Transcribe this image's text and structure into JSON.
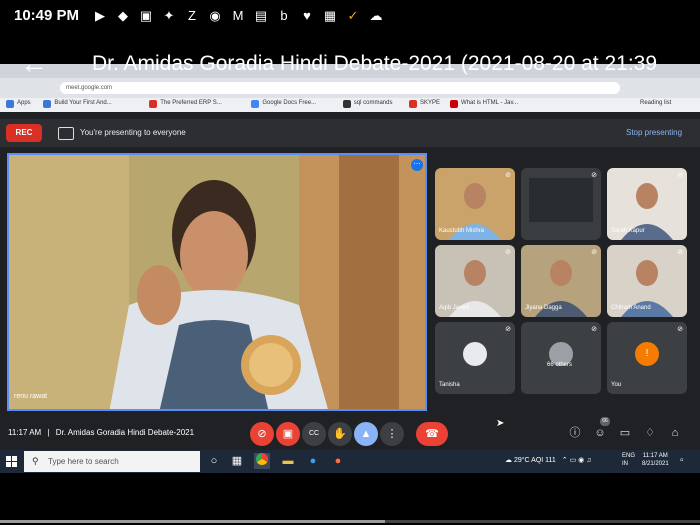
{
  "status_bar": {
    "time": "10:49 PM",
    "icons": [
      "youtube-icon",
      "shield-icon",
      "flipboard-icon",
      "twitter-icon",
      "zomato-icon",
      "snapchat-icon",
      "moneycontrol-icon",
      "newspaper-icon",
      "bb-icon",
      "health-icon",
      "scanner-icon",
      "check-icon",
      "cloud-icon"
    ]
  },
  "video": {
    "title": "Dr. Amidas Goradia Hindi Debate-2021 (2021-08-20 at 21:39",
    "progress": 0.55
  },
  "browser": {
    "bookmarks": [
      "Apps",
      "Build Your First And...",
      "The Preferred ERP S...",
      "Google Docs Free...",
      "sql commands",
      "SKYPE",
      "What is HTML - Jav..."
    ],
    "reading_list": "Reading list",
    "bookmark_colors": [
      "#3c78d8",
      "#3c78d8",
      "#d93025",
      "#4285f4",
      "#333333",
      "#d93025",
      "#cc0000"
    ]
  },
  "meet": {
    "rec_label": "REC",
    "presenting_text": "You're presenting to everyone",
    "stop_presenting": "Stop presenting",
    "main_speaker": "renu rawat",
    "meeting_time": "11:17 AM",
    "meeting_name": "Dr. Amidas Goradia Hindi Debate-2021",
    "participants": [
      {
        "name": "Kaustubh Mishra",
        "bg": "#c9a36a",
        "shirt": "#7fb2e5"
      },
      {
        "name": "",
        "bg": "#3a3d40",
        "shirt": "#3a3d40"
      },
      {
        "name": "Sarah Kapur",
        "bg": "#e6e1da",
        "shirt": "#5a6c8c"
      },
      {
        "name": "Aqib Javed",
        "bg": "#c7c1b6",
        "shirt": "#e8e8e8"
      },
      {
        "name": "Jiyana Dagga",
        "bg": "#b6a37e",
        "shirt": "#4d5b72"
      },
      {
        "name": "Chitram Anand",
        "bg": "#d8d2c8",
        "shirt": "#5b7aa3"
      },
      {
        "name": "Tanisha",
        "bg": "#3c4043",
        "shirt": ""
      },
      {
        "name": "66 others",
        "bg": "#3c4043",
        "shirt": ""
      },
      {
        "name": "You",
        "bg": "#3c4043",
        "shirt": ""
      }
    ],
    "controls": [
      "mic-off-icon",
      "camera-off-icon",
      "captions-icon",
      "raise-hand-icon",
      "present-icon",
      "more-options-icon",
      "end-call-icon"
    ],
    "right_controls": [
      "info-icon",
      "people-icon",
      "chat-icon",
      "activities-icon",
      "lock-icon"
    ],
    "people_count": "66"
  },
  "taskbar": {
    "search_placeholder": "Type here to search",
    "weather": "29°C",
    "aqi": "AQI 111",
    "lang": "ENG",
    "region": "IN",
    "time": "11:17 AM",
    "date": "8/21/2021"
  }
}
